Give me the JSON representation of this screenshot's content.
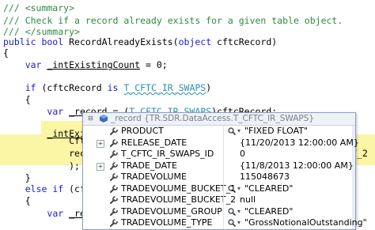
{
  "code": {
    "lines": [
      {
        "parts": [
          {
            "cls": "cmt",
            "t": "/// <summary>"
          }
        ]
      },
      {
        "parts": [
          {
            "cls": "cmt",
            "t": "/// Check if a record already exists for a given table object."
          }
        ]
      },
      {
        "parts": [
          {
            "cls": "cmt",
            "t": "/// </summary>"
          }
        ]
      },
      {
        "parts": [
          {
            "cls": "kw",
            "t": "public bool "
          },
          {
            "cls": "",
            "t": "RecordAlreadyExists("
          },
          {
            "cls": "kw",
            "t": "object "
          },
          {
            "cls": "",
            "t": "cftcRecord)"
          }
        ]
      },
      {
        "parts": [
          {
            "cls": "",
            "t": "{"
          }
        ]
      },
      {
        "parts": [
          {
            "cls": "",
            "t": "    "
          },
          {
            "cls": "kw",
            "t": "var "
          },
          {
            "cls": "ul",
            "t": "_intExistingCount"
          },
          {
            "cls": "",
            "t": " = 0;"
          }
        ]
      },
      {
        "parts": [
          {
            "cls": "",
            "t": ""
          }
        ]
      },
      {
        "parts": [
          {
            "cls": "",
            "t": "    "
          },
          {
            "cls": "kw",
            "t": "if "
          },
          {
            "cls": "",
            "t": "(cftcRecord "
          },
          {
            "cls": "kw",
            "t": "is "
          },
          {
            "cls": "ty squig",
            "t": "T_CFTC_IR_SWAPS"
          },
          {
            "cls": "",
            "t": ")"
          }
        ]
      },
      {
        "parts": [
          {
            "cls": "",
            "t": "    {"
          }
        ]
      },
      {
        "parts": [
          {
            "cls": "",
            "t": "        "
          },
          {
            "cls": "kw",
            "t": "var "
          },
          {
            "cls": "ul",
            "t": "_record"
          },
          {
            "cls": "",
            "t": " = ("
          },
          {
            "cls": "ty squig",
            "t": "T_CFTC_IR_SWAPS"
          },
          {
            "cls": "",
            "t": ")cftcRecord;"
          }
        ]
      },
      {
        "parts": [
          {
            "cls": "",
            "t": ""
          }
        ]
      },
      {
        "parts": [
          {
            "cls": "",
            "t": "        "
          },
          {
            "cls": "ul",
            "t": "_intExistin"
          }
        ]
      },
      {
        "parts": [
          {
            "cls": "",
            "t": "            CftcCon"
          }
        ]
      },
      {
        "parts": [
          {
            "cls": "",
            "t": "            rec =>"
          }
        ]
      },
      {
        "parts": [
          {
            "cls": "",
            "t": "            );"
          }
        ]
      },
      {
        "parts": [
          {
            "cls": "",
            "t": "    }"
          }
        ]
      },
      {
        "parts": [
          {
            "cls": "",
            "t": "    "
          },
          {
            "cls": "kw",
            "t": "else if "
          },
          {
            "cls": "",
            "t": "(cftcRe"
          }
        ]
      },
      {
        "parts": [
          {
            "cls": "",
            "t": "    {"
          }
        ]
      },
      {
        "parts": [
          {
            "cls": "",
            "t": "        "
          },
          {
            "cls": "kw",
            "t": "var "
          },
          {
            "cls": "ul",
            "t": "_record"
          }
        ]
      }
    ],
    "right_overflow": "T_2"
  },
  "datatip": {
    "header_text": "_record {TR.SDR.DataAccess.T_CFTC_IR_SWAPS}",
    "rows": [
      {
        "name": "PRODUCT",
        "value": "\"FIXED FLOAT\"",
        "expandable": false,
        "visualizer": true
      },
      {
        "name": "RELEASE_DATE",
        "value": "{11/20/2013 12:00:00 AM}",
        "expandable": true,
        "visualizer": false
      },
      {
        "name": "T_CFTC_IR_SWAPS_ID",
        "value": "0",
        "expandable": false,
        "visualizer": false
      },
      {
        "name": "TRADE_DATE",
        "value": "{11/8/2013 12:00:00 AM}",
        "expandable": true,
        "visualizer": false
      },
      {
        "name": "TRADEVOLUME",
        "value": "115048673",
        "expandable": false,
        "visualizer": false
      },
      {
        "name": "TRADEVOLUME_BUCKET_1",
        "value": "\"CLEARED\"",
        "expandable": false,
        "visualizer": true
      },
      {
        "name": "TRADEVOLUME_BUCKET_2",
        "value": "null",
        "expandable": false,
        "visualizer": false
      },
      {
        "name": "TRADEVOLUME_GROUP",
        "value": "\"CLEARED\"",
        "expandable": false,
        "visualizer": true
      },
      {
        "name": "TRADEVOLUME_TYPE",
        "value": "\"GrossNotionalOutstanding\"",
        "expandable": false,
        "visualizer": true
      }
    ]
  }
}
